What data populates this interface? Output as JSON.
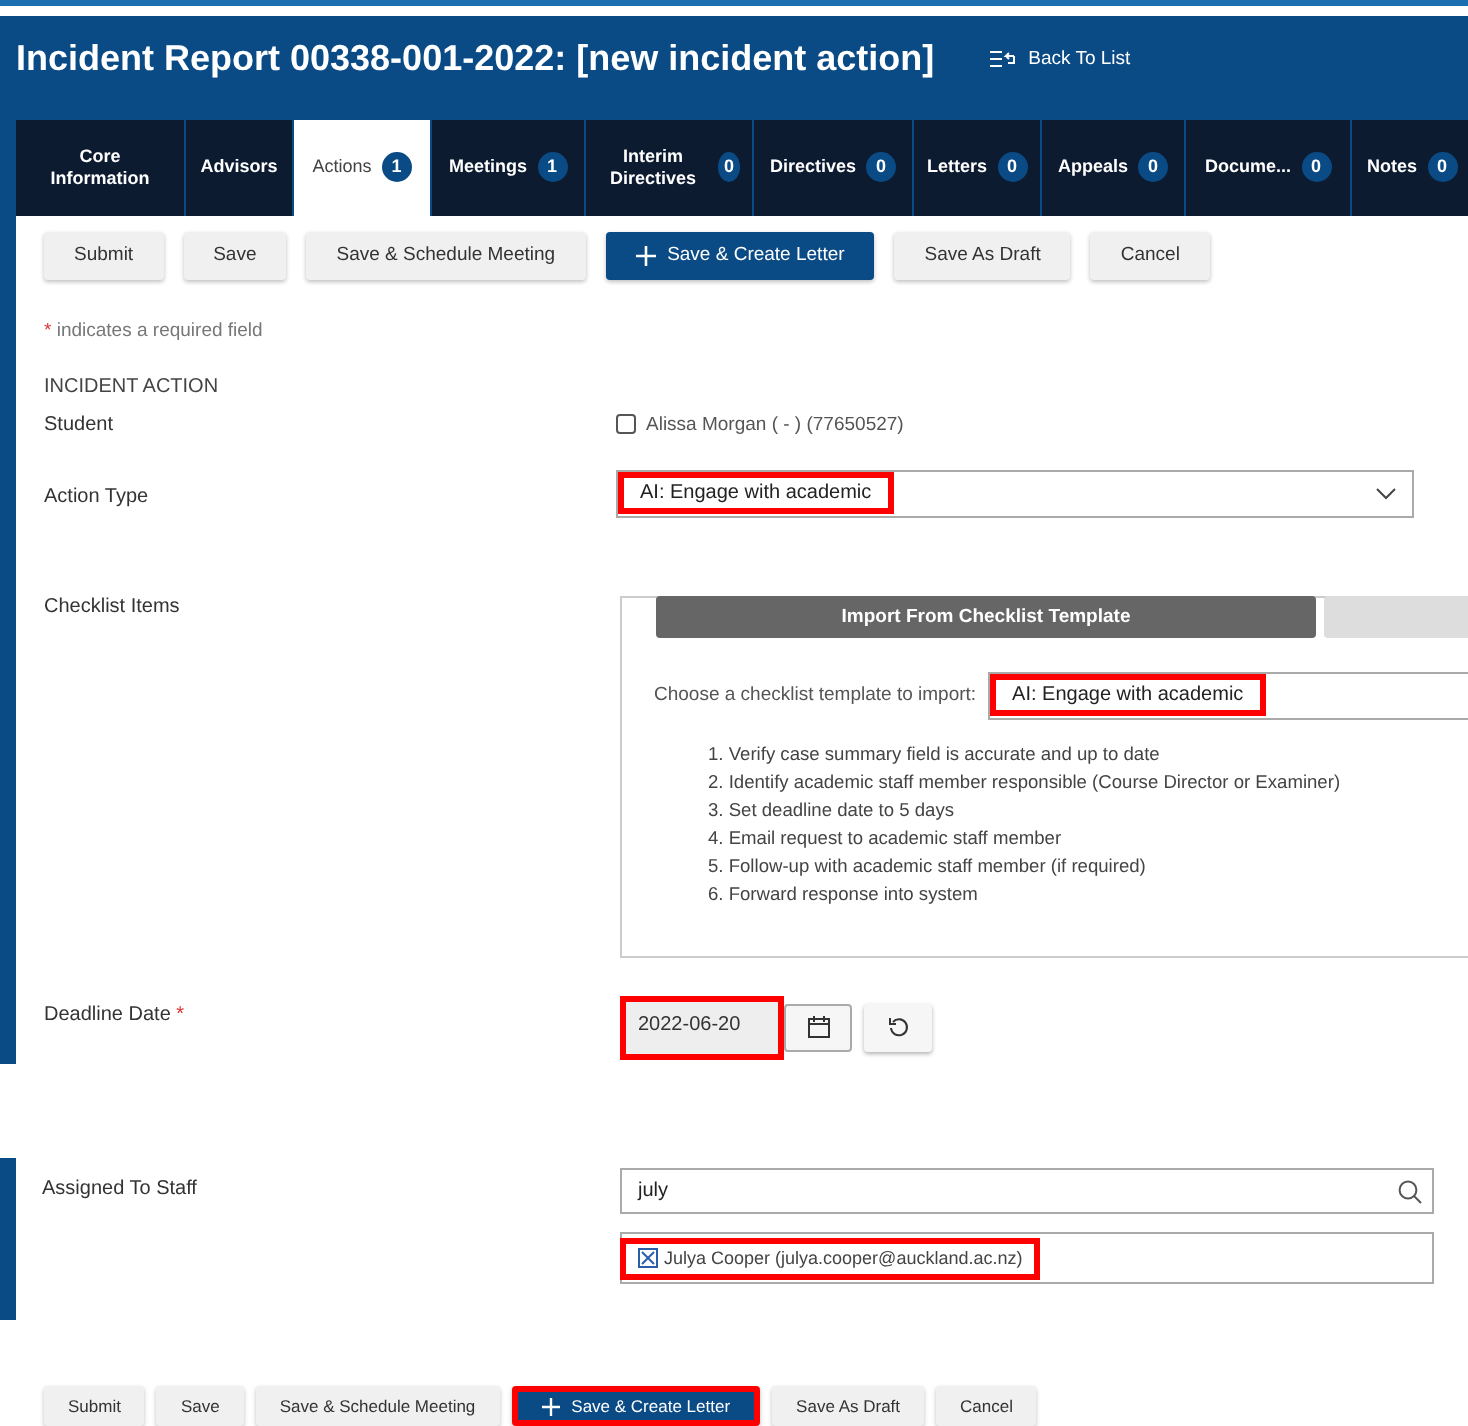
{
  "header": {
    "title": "Incident Report 00338-001-2022: [new incident action]",
    "back_link": "Back To List"
  },
  "tabs": [
    {
      "label": "Core Information",
      "selected": false
    },
    {
      "label": "Advisors",
      "selected": false
    },
    {
      "label": "Actions",
      "count": "1",
      "selected": true
    },
    {
      "label": "Meetings",
      "count": "1",
      "selected": false
    },
    {
      "label": "Interim Directives",
      "count": "0",
      "selected": false
    },
    {
      "label": "Directives",
      "count": "0",
      "selected": false
    },
    {
      "label": "Letters",
      "count": "0",
      "selected": false
    },
    {
      "label": "Appeals",
      "count": "0",
      "selected": false
    },
    {
      "label": "Docume...",
      "count": "0",
      "selected": false
    },
    {
      "label": "Notes",
      "count": "0",
      "selected": false
    }
  ],
  "toolbar": [
    {
      "label": "Submit",
      "primary": false
    },
    {
      "label": "Save",
      "primary": false
    },
    {
      "label": "Save & Schedule Meeting",
      "primary": false
    },
    {
      "label": "Save & Create Letter",
      "primary": true
    },
    {
      "label": "Save As Draft",
      "primary": false
    },
    {
      "label": "Cancel",
      "primary": false
    }
  ],
  "required_note": {
    "mark": "*",
    "text": "indicates a required field"
  },
  "section_title": "INCIDENT ACTION",
  "student": {
    "label": "Student",
    "value": "Alissa Morgan ( - ) (77650527)",
    "checked": false
  },
  "action_type": {
    "label": "Action Type",
    "value": "AI: Engage with academic",
    "highlighted": true
  },
  "checklist": {
    "label": "Checklist Items",
    "tab": "Import From Checklist Template",
    "prompt": "Choose a checklist template to import:",
    "template": "AI: Engage with academic",
    "highlighted": true,
    "items": [
      "1. Verify case summary field is accurate and up to date",
      "2. Identify academic staff member responsible (Course Director or Examiner)",
      "3. Set deadline date to 5 days",
      "4. Email request to academic staff member",
      "5. Follow-up with academic staff member (if required)",
      "6. Forward response into system"
    ]
  },
  "deadline": {
    "label": "Deadline Date",
    "mark": "*",
    "value": "2022-06-20",
    "highlighted": true
  },
  "assigned": {
    "label": "Assigned To Staff",
    "search": "july",
    "staff": "Julya Cooper (julya.cooper@auckland.ac.nz)",
    "highlighted": true
  },
  "bottom_toolbar": [
    {
      "label": "Submit",
      "primary": false,
      "highlighted": false
    },
    {
      "label": "Save",
      "primary": false,
      "highlighted": false
    },
    {
      "label": "Save & Schedule Meeting",
      "primary": false,
      "highlighted": false
    },
    {
      "label": "Save & Create Letter",
      "primary": true,
      "highlighted": true
    },
    {
      "label": "Save As Draft",
      "primary": false,
      "highlighted": false
    },
    {
      "label": "Cancel",
      "primary": false,
      "highlighted": false
    }
  ]
}
